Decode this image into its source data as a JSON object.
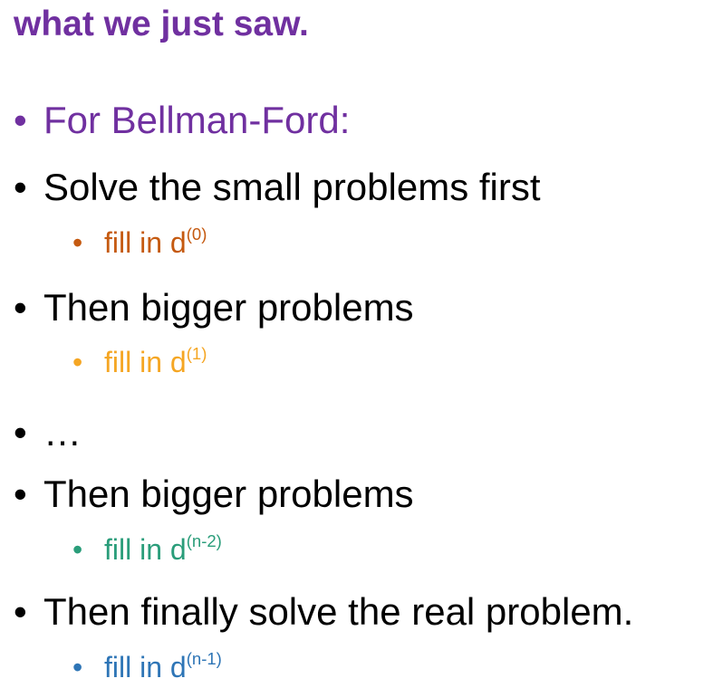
{
  "heading": "what we just saw.",
  "bullet_glyph": "•",
  "colors": {
    "purple": "#7030a0",
    "black": "#000000",
    "rust": "#c55a11",
    "orange": "#f5a623",
    "teal": "#2a9d7a",
    "blue": "#2e75b6"
  },
  "items": [
    {
      "level": 1,
      "text": "For Bellman-Ford:",
      "color": "purple"
    },
    {
      "level": 1,
      "text": "Solve the small problems first",
      "color": "black"
    },
    {
      "level": 2,
      "text": "fill in d",
      "sup": "(0)",
      "color": "rust"
    },
    {
      "level": 1,
      "text": "Then bigger problems",
      "color": "black"
    },
    {
      "level": 2,
      "text": "fill in d",
      "sup": "(1)",
      "color": "orange"
    },
    {
      "level": 1,
      "text": "…",
      "color": "black"
    },
    {
      "level": 1,
      "text": "Then bigger problems",
      "color": "black"
    },
    {
      "level": 2,
      "text": "fill in d",
      "sup": "(n-2)",
      "color": "teal"
    },
    {
      "level": 1,
      "text": "Then finally solve the real problem.",
      "color": "black"
    },
    {
      "level": 2,
      "text": "fill in d",
      "sup": "(n-1)",
      "color": "blue"
    }
  ]
}
